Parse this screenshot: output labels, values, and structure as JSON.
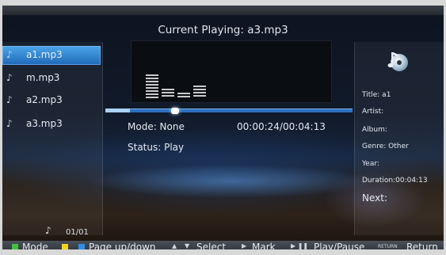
{
  "header": {
    "title": "Current Playing: a3.mp3"
  },
  "playlist": {
    "items": [
      {
        "label": "a1.mp3",
        "selected": true
      },
      {
        "label": "m.mp3",
        "selected": false
      },
      {
        "label": "a2.mp3",
        "selected": false
      },
      {
        "label": "a3.mp3",
        "selected": false
      }
    ],
    "page": "01/01"
  },
  "spectrum": {
    "levels": [
      0.62,
      0.24,
      0.14,
      0.34,
      0,
      0,
      0,
      0,
      0,
      0,
      0,
      0,
      0,
      0
    ]
  },
  "progress": {
    "fraction": 0.1
  },
  "status": {
    "mode": "Mode: None",
    "time": "00:00:24/00:04:13",
    "state": "Status: Play"
  },
  "info": {
    "icon": "music-cd-icon",
    "title": "Title: a1",
    "artist": "Artist:",
    "album": "Album:",
    "genre": "Genre: Other",
    "year": "Year:",
    "duration": "Duration:00:04:13",
    "next": "Next:"
  },
  "footer": {
    "mode": "Mode",
    "page": "Page up/down",
    "select": "Select",
    "mark": "Mark",
    "playpause": "Play/Pause",
    "return_badge": "RETURN",
    "return": "Return"
  },
  "colors": {
    "green": "#3ec13e",
    "yellow": "#f4d51c",
    "blue": "#2f8fe6",
    "accent": "#2d6fbf"
  }
}
